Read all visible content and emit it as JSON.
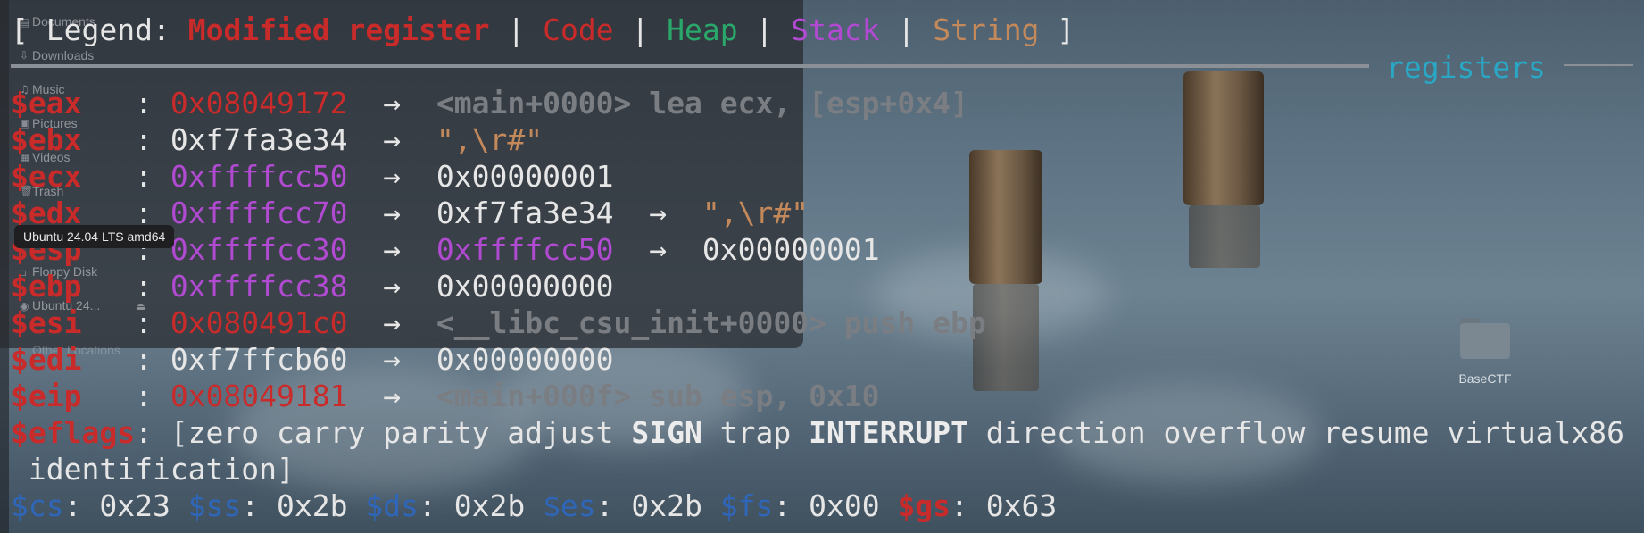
{
  "legend": {
    "open": "[ ",
    "label": "Legend: ",
    "modified": "Modified register",
    "sep": " | ",
    "code": "Code",
    "heap": "Heap",
    "stack": "Stack",
    "string": "String",
    "close": " ]"
  },
  "section_title": "registers",
  "registers": [
    {
      "name": "$eax",
      "sep": "   : ",
      "value": "0x08049172",
      "arrow": "  →  ",
      "target": "<main+0000> lea ecx, [esp+0x4]"
    },
    {
      "name": "$ebx",
      "sep": "   : ",
      "value": "0xf7fa3e34",
      "arrow": "  →  ",
      "target": "\",\\r#\""
    },
    {
      "name": "$ecx",
      "sep": "   : ",
      "value": "0xffffcc50",
      "arrow": "  →  ",
      "target": "0x00000001"
    },
    {
      "name": "$edx",
      "sep": "   : ",
      "value": "0xffffcc70",
      "arrow": "  →  ",
      "target": "0xf7fa3e34",
      "arrow2": "  →  ",
      "target2": "\",\\r#\""
    },
    {
      "name": "$esp",
      "sep": "   : ",
      "value": "0xffffcc30",
      "arrow": "  →  ",
      "target": "0xffffcc50",
      "arrow2": "  →  ",
      "target2": "0x00000001"
    },
    {
      "name": "$ebp",
      "sep": "   : ",
      "value": "0xffffcc38",
      "arrow": "  →  ",
      "target": "0x00000000"
    },
    {
      "name": "$esi",
      "sep": "   : ",
      "value": "0x080491c0",
      "arrow": "  →  ",
      "target": "<__libc_csu_init+0000> push ebp"
    },
    {
      "name": "$edi",
      "sep": "   : ",
      "value": "0xf7ffcb60",
      "arrow": "  →  ",
      "target": "0x00000000"
    },
    {
      "name": "$eip",
      "sep": "   : ",
      "value": "0x08049181",
      "arrow": "  →  ",
      "target": "<main+000f> sub esp, 0x10"
    }
  ],
  "eflags": {
    "name": "$eflags",
    "open": ": [",
    "f1": "zero carry parity adjust ",
    "sign": "SIGN",
    "f2": " trap ",
    "interrupt": "INTERRUPT",
    "f3": " direction overflow resume virtualx86",
    "line2": " identification]"
  },
  "segments": [
    {
      "name": "$cs",
      "value": ": 0x23 "
    },
    {
      "name": "$ss",
      "value": ": 0x2b "
    },
    {
      "name": "$ds",
      "value": ": 0x2b "
    },
    {
      "name": "$es",
      "value": ": 0x2b "
    },
    {
      "name": "$fs",
      "value": ": 0x00 "
    },
    {
      "name": "$gs",
      "value": ": 0x63"
    }
  ],
  "file_manager": {
    "items": [
      "Documents",
      "Downloads",
      "Music",
      "Pictures",
      "Videos",
      "Trash",
      "Floppy Disk",
      "Ubuntu 24...",
      "Other Locations"
    ],
    "tooltip": "Ubuntu 24.04 LTS amd64"
  },
  "desktop": {
    "folder_label": "BaseCTF"
  },
  "colors": {
    "modified": "#c92a2a",
    "code": "#c92a2a",
    "heap": "#2aa76a",
    "stack": "#b04ad0",
    "string": "#c4895a",
    "section": "#2aa7c4",
    "segment": "#2f66b8"
  }
}
